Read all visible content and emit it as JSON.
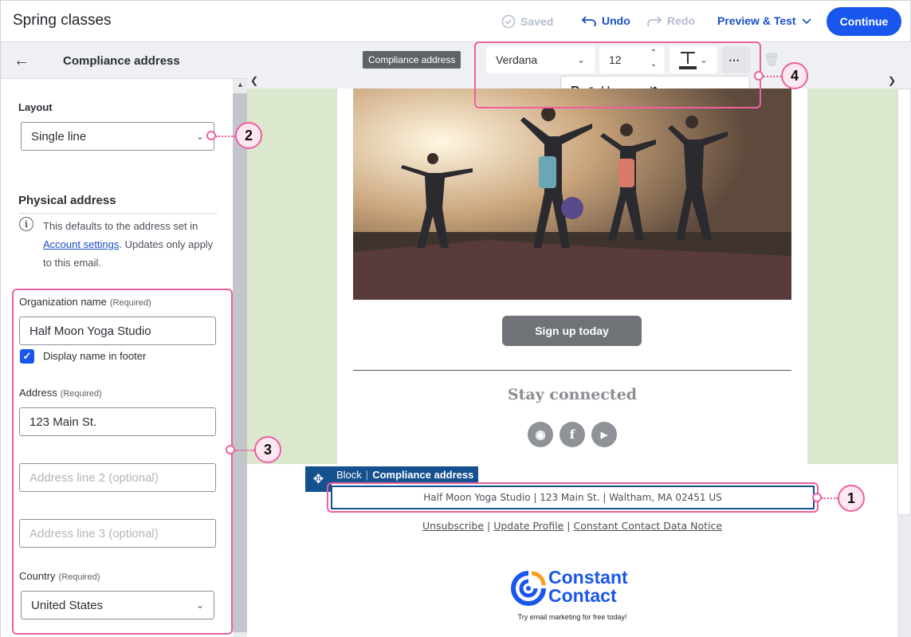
{
  "header": {
    "title": "Spring classes",
    "saved_label": "Saved",
    "undo_label": "Undo",
    "redo_label": "Redo",
    "preview_label": "Preview & Test",
    "continue_label": "Continue"
  },
  "panel": {
    "title": "Compliance address",
    "layout_label": "Layout",
    "layout_value": "Single line",
    "physical_title": "Physical address",
    "info_before": "This defaults to the address set in ",
    "info_link": "Account settings",
    "info_after": ". Updates only apply to this email.",
    "org_label": "Organization name",
    "required": "(Required)",
    "org_value": "Half Moon Yoga Studio",
    "display_name_label": "Display name in footer",
    "address_label": "Address",
    "address_value": "123 Main St.",
    "address2_placeholder": "Address line 2 (optional)",
    "address3_placeholder": "Address line 3 (optional)",
    "country_label": "Country",
    "country_value": "United States"
  },
  "toolbar": {
    "element_tag": "Compliance address",
    "font": "Verdana",
    "size": "12"
  },
  "email": {
    "cta_label": "Sign up today",
    "stay_connected": "Stay connected",
    "block_word": "Block",
    "block_name": "Compliance address",
    "address_line": "Half Moon Yoga Studio | 123 Main St. | Waltham, MA 02451 US",
    "unsubscribe": "Unsubscribe",
    "update_profile": "Update Profile",
    "data_notice": "Constant Contact Data Notice",
    "logo_line1": "Constant",
    "logo_line2": "Contact",
    "tagline": "Try email marketing for free today!"
  },
  "callouts": [
    "1",
    "2",
    "3",
    "4"
  ],
  "colors": {
    "accent": "#1856ed",
    "highlight": "#ee5fa0",
    "block": "#15508f",
    "green_bg": "#dbe8cd"
  }
}
